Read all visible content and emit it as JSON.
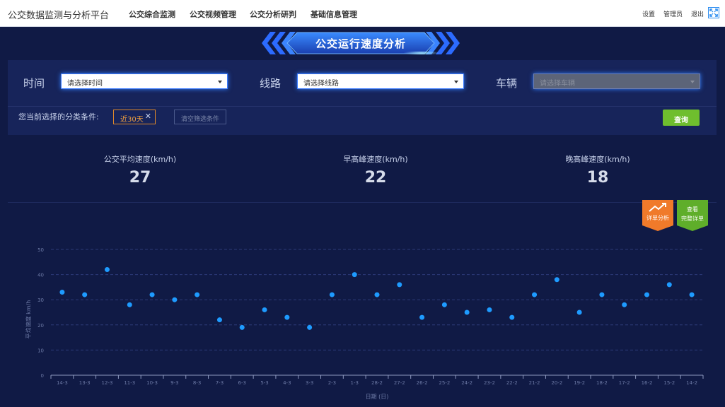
{
  "app": {
    "title": "公交数据监测与分析平台",
    "nav": [
      "公交综合监测",
      "公交视频管理",
      "公交分析研判",
      "基础信息管理"
    ],
    "top_right": {
      "settings": "设置",
      "user": "管理员",
      "logout": "退出"
    },
    "icons": {
      "fullscreen": "fullscreen-icon"
    }
  },
  "banner": {
    "title": "公交运行速度分析"
  },
  "filters": {
    "time_label": "时间",
    "time_placeholder": "请选择时间",
    "route_label": "线路",
    "route_placeholder": "请选择线路",
    "vehicle_label": "车辆",
    "vehicle_placeholder": "请选择车辆",
    "condition_label": "您当前选择的分类条件:",
    "active_tag": "近30天",
    "clear_label": "清空筛选条件",
    "query_label": "查询"
  },
  "stats": [
    {
      "label": "公交平均速度(km/h)",
      "value": "27"
    },
    {
      "label": "早高峰速度(km/h)",
      "value": "22"
    },
    {
      "label": "晚高峰速度(km/h)",
      "value": "18"
    }
  ],
  "side_buttons": {
    "detail": "详单分析",
    "view_line1": "查看",
    "view_line2": "完整详单"
  },
  "colors": {
    "accent_orange": "#f07a2a",
    "accent_green": "#5fae2a",
    "point": "#1e9bff",
    "tag_border": "#e08a2a"
  },
  "chart_data": {
    "type": "scatter",
    "xlabel": "日期 (日)",
    "ylabel": "平均速度 km/h",
    "ylim": [
      0,
      50
    ],
    "yticks": [
      0,
      10,
      20,
      30,
      40,
      50
    ],
    "grid": true,
    "categories": [
      "14-3",
      "13-3",
      "12-3",
      "11-3",
      "10-3",
      "9-3",
      "8-3",
      "7-3",
      "6-3",
      "5-3",
      "4-3",
      "3-3",
      "2-3",
      "1-3",
      "28-2",
      "27-2",
      "26-2",
      "25-2",
      "24-2",
      "23-2",
      "22-2",
      "21-2",
      "20-2",
      "19-2",
      "18-2",
      "17-2",
      "16-2",
      "15-2",
      "14-2"
    ],
    "values": [
      33,
      32,
      42,
      28,
      32,
      30,
      32,
      22,
      19,
      26,
      23,
      19,
      32,
      40,
      32,
      36,
      23,
      28,
      25,
      26,
      23,
      32,
      38,
      25,
      32,
      28,
      32,
      36,
      32
    ]
  }
}
